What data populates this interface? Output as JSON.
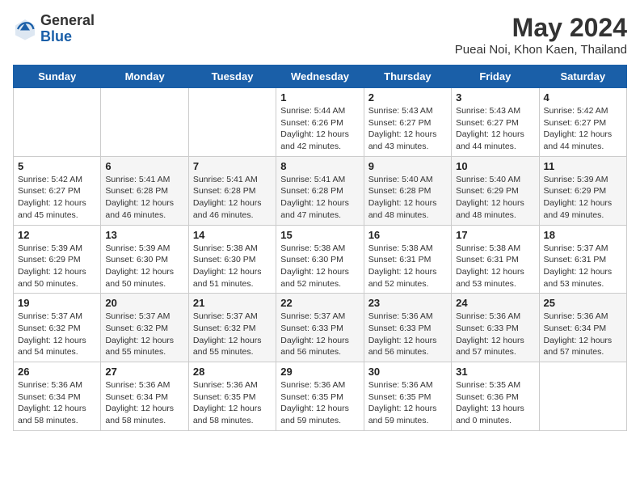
{
  "header": {
    "logo_general": "General",
    "logo_blue": "Blue",
    "title": "May 2024",
    "subtitle": "Pueai Noi, Khon Kaen, Thailand"
  },
  "weekdays": [
    "Sunday",
    "Monday",
    "Tuesday",
    "Wednesday",
    "Thursday",
    "Friday",
    "Saturday"
  ],
  "weeks": [
    [
      {
        "day": "",
        "info": ""
      },
      {
        "day": "",
        "info": ""
      },
      {
        "day": "",
        "info": ""
      },
      {
        "day": "1",
        "info": "Sunrise: 5:44 AM\nSunset: 6:26 PM\nDaylight: 12 hours\nand 42 minutes."
      },
      {
        "day": "2",
        "info": "Sunrise: 5:43 AM\nSunset: 6:27 PM\nDaylight: 12 hours\nand 43 minutes."
      },
      {
        "day": "3",
        "info": "Sunrise: 5:43 AM\nSunset: 6:27 PM\nDaylight: 12 hours\nand 44 minutes."
      },
      {
        "day": "4",
        "info": "Sunrise: 5:42 AM\nSunset: 6:27 PM\nDaylight: 12 hours\nand 44 minutes."
      }
    ],
    [
      {
        "day": "5",
        "info": "Sunrise: 5:42 AM\nSunset: 6:27 PM\nDaylight: 12 hours\nand 45 minutes."
      },
      {
        "day": "6",
        "info": "Sunrise: 5:41 AM\nSunset: 6:28 PM\nDaylight: 12 hours\nand 46 minutes."
      },
      {
        "day": "7",
        "info": "Sunrise: 5:41 AM\nSunset: 6:28 PM\nDaylight: 12 hours\nand 46 minutes."
      },
      {
        "day": "8",
        "info": "Sunrise: 5:41 AM\nSunset: 6:28 PM\nDaylight: 12 hours\nand 47 minutes."
      },
      {
        "day": "9",
        "info": "Sunrise: 5:40 AM\nSunset: 6:28 PM\nDaylight: 12 hours\nand 48 minutes."
      },
      {
        "day": "10",
        "info": "Sunrise: 5:40 AM\nSunset: 6:29 PM\nDaylight: 12 hours\nand 48 minutes."
      },
      {
        "day": "11",
        "info": "Sunrise: 5:39 AM\nSunset: 6:29 PM\nDaylight: 12 hours\nand 49 minutes."
      }
    ],
    [
      {
        "day": "12",
        "info": "Sunrise: 5:39 AM\nSunset: 6:29 PM\nDaylight: 12 hours\nand 50 minutes."
      },
      {
        "day": "13",
        "info": "Sunrise: 5:39 AM\nSunset: 6:30 PM\nDaylight: 12 hours\nand 50 minutes."
      },
      {
        "day": "14",
        "info": "Sunrise: 5:38 AM\nSunset: 6:30 PM\nDaylight: 12 hours\nand 51 minutes."
      },
      {
        "day": "15",
        "info": "Sunrise: 5:38 AM\nSunset: 6:30 PM\nDaylight: 12 hours\nand 52 minutes."
      },
      {
        "day": "16",
        "info": "Sunrise: 5:38 AM\nSunset: 6:31 PM\nDaylight: 12 hours\nand 52 minutes."
      },
      {
        "day": "17",
        "info": "Sunrise: 5:38 AM\nSunset: 6:31 PM\nDaylight: 12 hours\nand 53 minutes."
      },
      {
        "day": "18",
        "info": "Sunrise: 5:37 AM\nSunset: 6:31 PM\nDaylight: 12 hours\nand 53 minutes."
      }
    ],
    [
      {
        "day": "19",
        "info": "Sunrise: 5:37 AM\nSunset: 6:32 PM\nDaylight: 12 hours\nand 54 minutes."
      },
      {
        "day": "20",
        "info": "Sunrise: 5:37 AM\nSunset: 6:32 PM\nDaylight: 12 hours\nand 55 minutes."
      },
      {
        "day": "21",
        "info": "Sunrise: 5:37 AM\nSunset: 6:32 PM\nDaylight: 12 hours\nand 55 minutes."
      },
      {
        "day": "22",
        "info": "Sunrise: 5:37 AM\nSunset: 6:33 PM\nDaylight: 12 hours\nand 56 minutes."
      },
      {
        "day": "23",
        "info": "Sunrise: 5:36 AM\nSunset: 6:33 PM\nDaylight: 12 hours\nand 56 minutes."
      },
      {
        "day": "24",
        "info": "Sunrise: 5:36 AM\nSunset: 6:33 PM\nDaylight: 12 hours\nand 57 minutes."
      },
      {
        "day": "25",
        "info": "Sunrise: 5:36 AM\nSunset: 6:34 PM\nDaylight: 12 hours\nand 57 minutes."
      }
    ],
    [
      {
        "day": "26",
        "info": "Sunrise: 5:36 AM\nSunset: 6:34 PM\nDaylight: 12 hours\nand 58 minutes."
      },
      {
        "day": "27",
        "info": "Sunrise: 5:36 AM\nSunset: 6:34 PM\nDaylight: 12 hours\nand 58 minutes."
      },
      {
        "day": "28",
        "info": "Sunrise: 5:36 AM\nSunset: 6:35 PM\nDaylight: 12 hours\nand 58 minutes."
      },
      {
        "day": "29",
        "info": "Sunrise: 5:36 AM\nSunset: 6:35 PM\nDaylight: 12 hours\nand 59 minutes."
      },
      {
        "day": "30",
        "info": "Sunrise: 5:36 AM\nSunset: 6:35 PM\nDaylight: 12 hours\nand 59 minutes."
      },
      {
        "day": "31",
        "info": "Sunrise: 5:35 AM\nSunset: 6:36 PM\nDaylight: 13 hours\nand 0 minutes."
      },
      {
        "day": "",
        "info": ""
      }
    ]
  ]
}
